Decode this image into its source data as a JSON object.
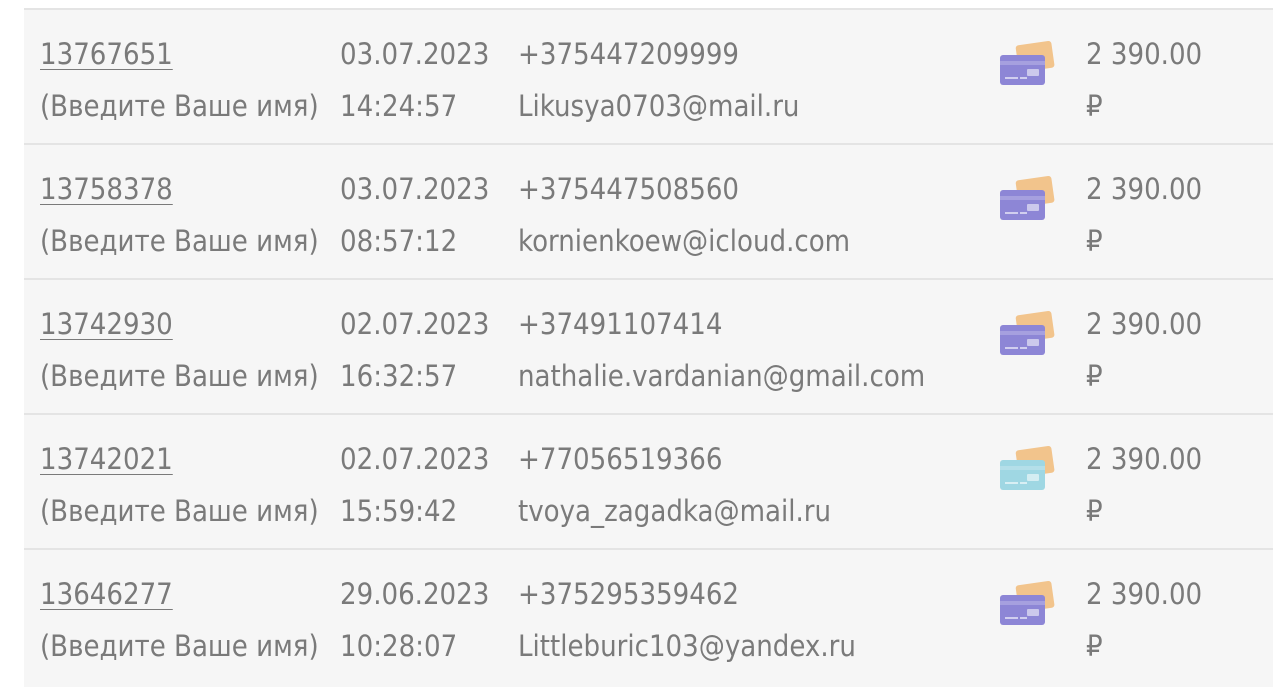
{
  "orders": [
    {
      "id": "13767651",
      "name": "(Введите Ваше имя)",
      "date": "03.07.2023",
      "time": "14:24:57",
      "phone": "+375447209999",
      "email": "Likusya0703@mail.ru",
      "payment_icon": "bank-card-icon",
      "card_color": "#8d86d6",
      "amount": "2 390.00",
      "currency": "₽"
    },
    {
      "id": "13758378",
      "name": "(Введите Ваше имя)",
      "date": "03.07.2023",
      "time": "08:57:12",
      "phone": "+375447508560",
      "email": "kornienkoew@icloud.com",
      "payment_icon": "bank-card-icon",
      "card_color": "#8d86d6",
      "amount": "2 390.00",
      "currency": "₽"
    },
    {
      "id": "13742930",
      "name": "(Введите Ваше имя)",
      "date": "02.07.2023",
      "time": "16:32:57",
      "phone": "+37491107414",
      "email": "nathalie.vardanian@gmail.com",
      "payment_icon": "bank-card-icon",
      "card_color": "#8d86d6",
      "amount": "2 390.00",
      "currency": "₽"
    },
    {
      "id": "13742021",
      "name": "(Введите Ваше имя)",
      "date": "02.07.2023",
      "time": "15:59:42",
      "phone": "+77056519366",
      "email": "tvoya_zagadka@mail.ru",
      "payment_icon": "bank-card-icon",
      "card_color": "#9fd7e3",
      "amount": "2 390.00",
      "currency": "₽"
    },
    {
      "id": "13646277",
      "name": "(Введите Ваше имя)",
      "date": "29.06.2023",
      "time": "10:28:07",
      "phone": "+375295359462",
      "email": "Littleburic103@yandex.ru",
      "payment_icon": "bank-card-icon",
      "card_color": "#8d86d6",
      "amount": "2 390.00",
      "currency": "₽"
    }
  ]
}
